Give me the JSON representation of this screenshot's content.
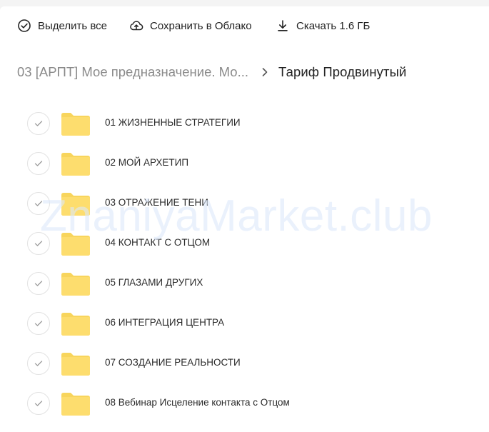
{
  "toolbar": {
    "select_all_label": "Выделить все",
    "save_cloud_label": "Сохранить в Облако",
    "download_label": "Скачать 1.6 ГБ"
  },
  "breadcrumb": {
    "parent": "03 [АРПТ] Мое предназначение. Мо...",
    "current": "Тариф Продвинутый"
  },
  "items": [
    {
      "name": "01 ЖИЗНЕННЫЕ СТРАТЕГИИ",
      "icon": "folder-icon"
    },
    {
      "name": "02 МОЙ АРХЕТИП",
      "icon": "folder-icon"
    },
    {
      "name": "03 ОТРАЖЕНИЕ ТЕНИ",
      "icon": "folder-icon"
    },
    {
      "name": "04 КОНТАКТ С ОТЦОМ",
      "icon": "folder-icon"
    },
    {
      "name": "05 ГЛАЗАМИ ДРУГИХ",
      "icon": "folder-icon"
    },
    {
      "name": "06 ИНТЕГРАЦИЯ ЦЕНТРА",
      "icon": "folder-icon"
    },
    {
      "name": "07 СОЗДАНИЕ РЕАЛЬНОСТИ",
      "icon": "folder-icon"
    },
    {
      "name": "08 Вебинар Исцеление контакта с Отцом",
      "icon": "folder-icon"
    }
  ],
  "watermark": "ZnaniyaMarket.club",
  "colors": {
    "folder": "#fddd6e",
    "folder_tab": "#f8d55c",
    "check_border": "#e2e2e2",
    "text_secondary": "#8a8a8a"
  }
}
